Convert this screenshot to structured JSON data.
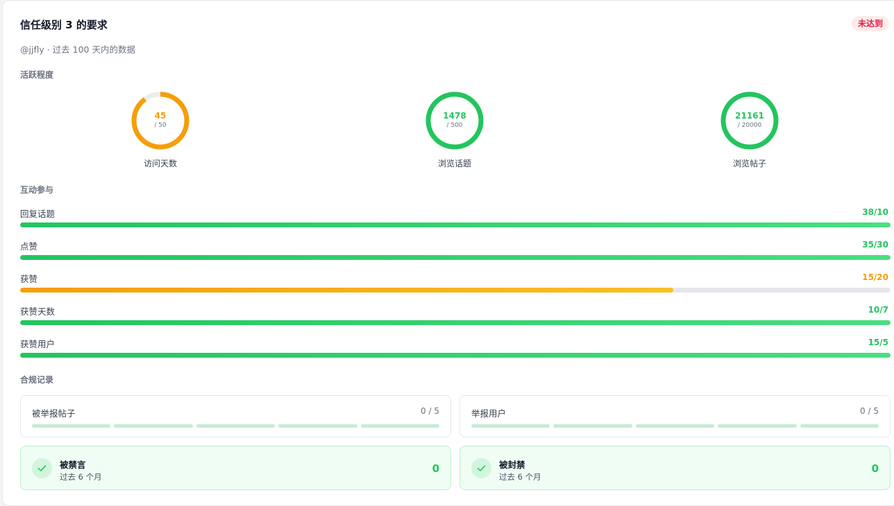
{
  "header": {
    "title": "信任级别 3 的要求",
    "badge": "未达到",
    "subtitle": "@jjfly · 过去 100 天内的数据"
  },
  "activity": {
    "section_title": "活跃程度",
    "rings": [
      {
        "value": "45",
        "target": "/ 50",
        "label": "访问天数",
        "fraction": 0.9,
        "color": "#f59e0b"
      },
      {
        "value": "1478",
        "target": "/ 500",
        "label": "浏览话题",
        "fraction": 1.0,
        "color": "#22c55e"
      },
      {
        "value": "21161",
        "target": "/ 20000",
        "label": "浏览帖子",
        "fraction": 1.0,
        "color": "#22c55e"
      }
    ]
  },
  "engagement": {
    "section_title": "互动参与",
    "rows": [
      {
        "label": "回复话题",
        "value": "38/10",
        "fraction": 1.0,
        "status": "green"
      },
      {
        "label": "点赞",
        "value": "35/30",
        "fraction": 1.0,
        "status": "green"
      },
      {
        "label": "获赞",
        "value": "15/20",
        "fraction": 0.75,
        "status": "orange"
      },
      {
        "label": "获赞天数",
        "value": "10/7",
        "fraction": 1.0,
        "status": "green"
      },
      {
        "label": "获赞用户",
        "value": "15/5",
        "fraction": 1.0,
        "status": "green"
      }
    ]
  },
  "compliance": {
    "section_title": "合规记录",
    "reports": [
      {
        "label": "被举报帖子",
        "count": "0 / 5",
        "segments": 5
      },
      {
        "label": "举报用户",
        "count": "0 / 5",
        "segments": 5
      }
    ],
    "statuses": [
      {
        "name": "被禁言",
        "sub": "过去 6 个月",
        "count": "0",
        "icon": "check-icon"
      },
      {
        "name": "被封禁",
        "sub": "过去 6 个月",
        "count": "0",
        "icon": "check-icon"
      }
    ]
  },
  "colors": {
    "green": "#22c55e",
    "orange": "#f59e0b",
    "danger": "#e11d48"
  }
}
